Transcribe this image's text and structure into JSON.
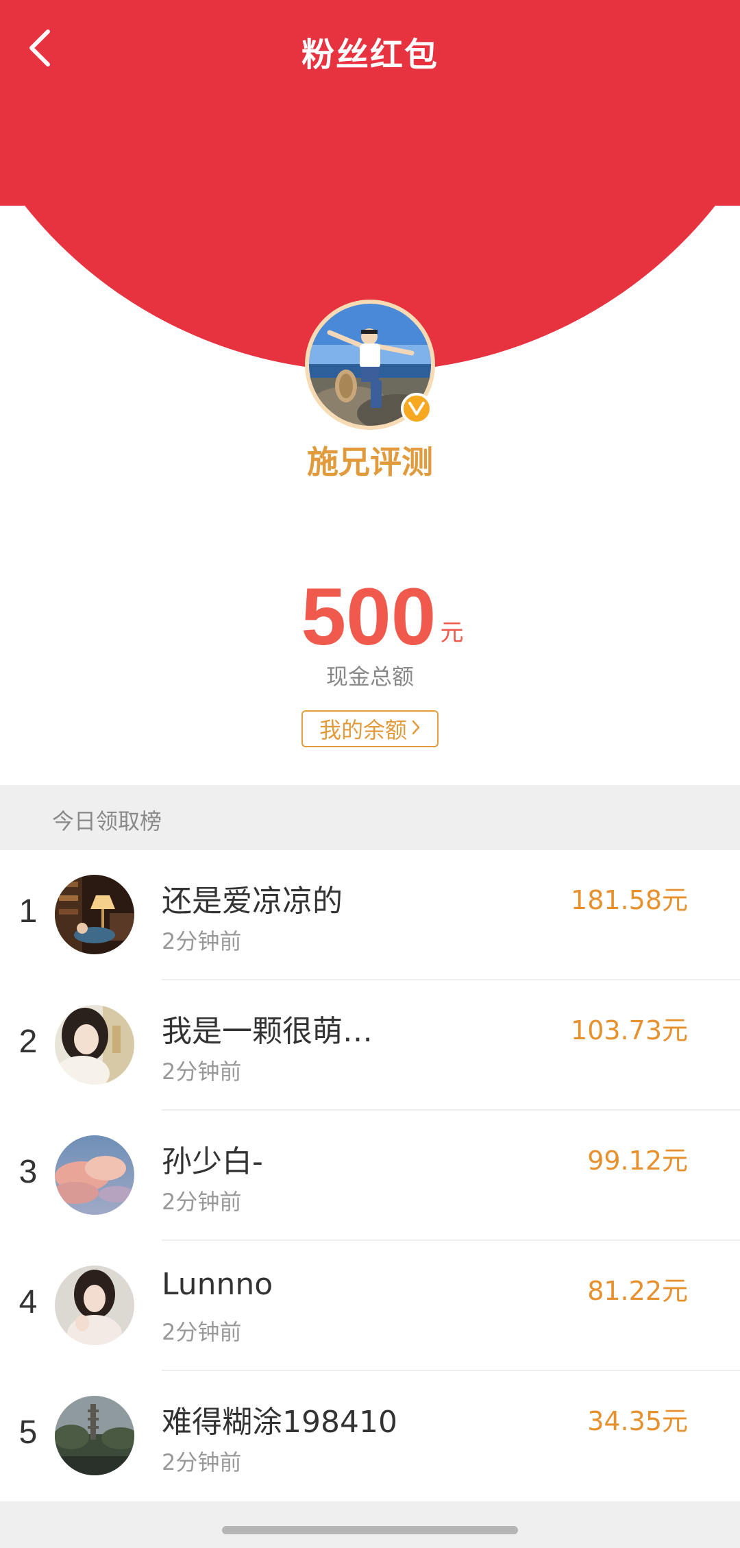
{
  "header": {
    "title": "粉丝红包"
  },
  "author": {
    "name": "施兄评测",
    "verified_badge": "V"
  },
  "amount": {
    "value": "500",
    "unit": "元",
    "caption": "现金总额",
    "balance_button": "我的余额"
  },
  "ranking": {
    "title": "今日领取榜",
    "rows": [
      {
        "rank": "1",
        "name": "还是爱凉凉的",
        "time": "2分钟前",
        "amount": "181.58元"
      },
      {
        "rank": "2",
        "name": "我是一颗很萌…",
        "time": "2分钟前",
        "amount": "103.73元"
      },
      {
        "rank": "3",
        "name": "孙少白-",
        "time": "2分钟前",
        "amount": "99.12元"
      },
      {
        "rank": "4",
        "name": "Lunnno",
        "time": "2分钟前",
        "amount": "81.22元"
      },
      {
        "rank": "5",
        "name": "难得糊涂198410",
        "time": "2分钟前",
        "amount": "34.35元"
      }
    ]
  },
  "colors": {
    "header_red": "#e73240",
    "cream": "#fbe3c4",
    "gold_text": "#e19b3c",
    "amount_red": "#f05a4d",
    "rank_amount": "#e6902e"
  },
  "icons": {
    "back": "chevron-left-icon",
    "verified": "verified-badge-icon",
    "balance_chevron": "chevron-right-icon"
  }
}
